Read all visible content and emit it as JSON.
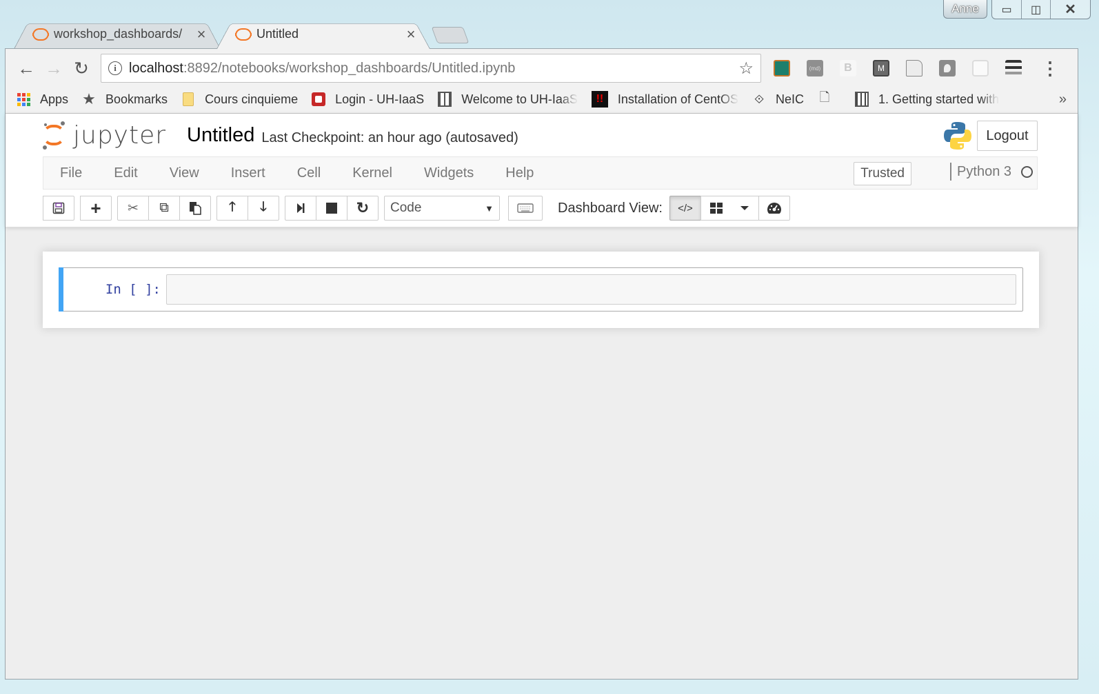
{
  "os": {
    "profile_name": "Anne",
    "window_buttons": {
      "minimize": "▭",
      "maximize": "◫",
      "close": "✕"
    }
  },
  "browser": {
    "tabs": [
      {
        "title": "workshop_dashboards/",
        "icon": "jupyter-icon",
        "active": false,
        "close": "×"
      },
      {
        "title": "Untitled",
        "icon": "jupyter-icon",
        "active": true,
        "close": "×"
      }
    ],
    "nav": {
      "back": "←",
      "forward": "→",
      "reload": "↻"
    },
    "url": {
      "host": "localhost",
      "rest": ":8892/notebooks/workshop_dashboards/Untitled.ipynb"
    },
    "star": "☆",
    "menu": "⋮",
    "bookmarks": [
      {
        "label": "Apps",
        "icon": "apps-grid-icon"
      },
      {
        "label": "Bookmarks",
        "icon": "star-icon"
      },
      {
        "label": "Cours cinquieme",
        "icon": "folder-icon"
      },
      {
        "label": "Login - UH-IaaS",
        "icon": "red-app-icon"
      },
      {
        "label": "Welcome to UH-IaaS",
        "icon": "grid-page-icon"
      },
      {
        "label": "Installation of CentOS",
        "icon": "alert-icon"
      },
      {
        "label": "NeIC",
        "icon": "neic-icon"
      },
      {
        "label": "",
        "icon": "page-icon"
      },
      {
        "label": "1. Getting started with",
        "icon": "book-icon"
      }
    ],
    "bookmarks_overflow": "»"
  },
  "jupyter": {
    "logo_text": "jupyter",
    "notebook_title": "Untitled",
    "checkpoint": "Last Checkpoint: an hour ago (autosaved)",
    "logout_label": "Logout",
    "menu": [
      "File",
      "Edit",
      "View",
      "Insert",
      "Cell",
      "Kernel",
      "Widgets",
      "Help"
    ],
    "trusted_label": "Trusted",
    "kernel_name": "Python 3",
    "toolbar": {
      "cell_type": "Code",
      "dashboard_label": "Dashboard View:",
      "icons": {
        "save": "🖫",
        "add": "+",
        "cut": "✂",
        "copy": "⧉",
        "paste": "📋",
        "up": "🡑",
        "down": "🡓",
        "run": "⏭",
        "stop": "■",
        "restart": "↻",
        "keyboard": "⌨",
        "code_view": "</>",
        "grid": "▦",
        "caret": "▾",
        "dashboard": "◕"
      }
    },
    "cells": [
      {
        "prompt": "In [ ]:",
        "source": ""
      }
    ]
  }
}
